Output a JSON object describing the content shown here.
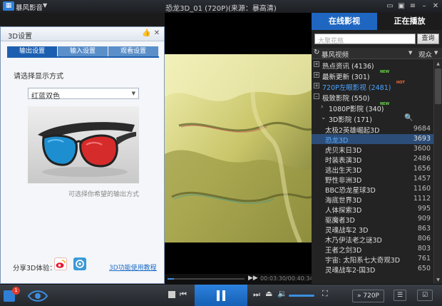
{
  "titlebar": {
    "app_name": "暴风影音",
    "window_title": "恐龙3D_01 (720P)(来源：暴高清)"
  },
  "dialog": {
    "title": "3D设置",
    "tabs": [
      "输出设置",
      "输入设置",
      "观看设置"
    ],
    "active_tab": 0,
    "prompt": "请选择显示方式",
    "select_value": "红蓝双色",
    "preview_caption": "可选择你希望的输出方式",
    "share_label": "分享3D体验：",
    "help_link": "3D功能使用教程"
  },
  "right_panel": {
    "tab_online": "在线影视",
    "tab_playing": "正在播放",
    "search_placeholder": "大聚花瓶",
    "search_button": "查询",
    "source_name": "暴风视频",
    "view_label": "观众"
  },
  "tree": {
    "categories": [
      {
        "label": "热点资讯 (4136)",
        "tag": "",
        "color": "normal"
      },
      {
        "label": "最新更新 (301)",
        "tag": "NEW",
        "color": "normal"
      },
      {
        "label": "720P左眼影视 (2481)",
        "tag": "HOT",
        "color": "blue"
      },
      {
        "label": "极致影院 (550)",
        "tag": "",
        "color": "normal",
        "expanded": true
      }
    ],
    "subcategories": [
      {
        "label": "1080P影院 (340)",
        "tag": "NEW"
      },
      {
        "label": "3D影院 (171)",
        "tag": "",
        "expanded": true
      }
    ],
    "videos": [
      {
        "title": "太极2英雄崛起3D",
        "count": "9684"
      },
      {
        "title": "恐龙3D",
        "count": "3693",
        "selected": true
      },
      {
        "title": "虎贝末日3D",
        "count": "3600"
      },
      {
        "title": "时装表演3D",
        "count": "2486"
      },
      {
        "title": "逃出生天3D",
        "count": "1656"
      },
      {
        "title": "野性非洲3D",
        "count": "1457"
      },
      {
        "title": "BBC恐龙星球3D",
        "count": "1160"
      },
      {
        "title": "海底世界3D",
        "count": "1112"
      },
      {
        "title": "人体探索3D",
        "count": "995"
      },
      {
        "title": "驱魔者3D",
        "count": "909"
      },
      {
        "title": "灵魂战车2 3D",
        "count": "863"
      },
      {
        "title": "木乃伊法老之谜3D",
        "count": "806"
      },
      {
        "title": "王者之剑3D",
        "count": "803"
      },
      {
        "title": "宇宙: 太阳系七大奇观3D",
        "count": "761"
      },
      {
        "title": "灵魂战车2-国3D",
        "count": "650"
      }
    ]
  },
  "player": {
    "time_display": "00:03:30/00:40:34",
    "quality_label": "720P",
    "notification_count": "1",
    "volume_level": 0.8,
    "progress": 0.086
  },
  "colors": {
    "accent": "#1f66c1",
    "selected_row": "#2c4d78",
    "link": "#1d6cc7"
  }
}
